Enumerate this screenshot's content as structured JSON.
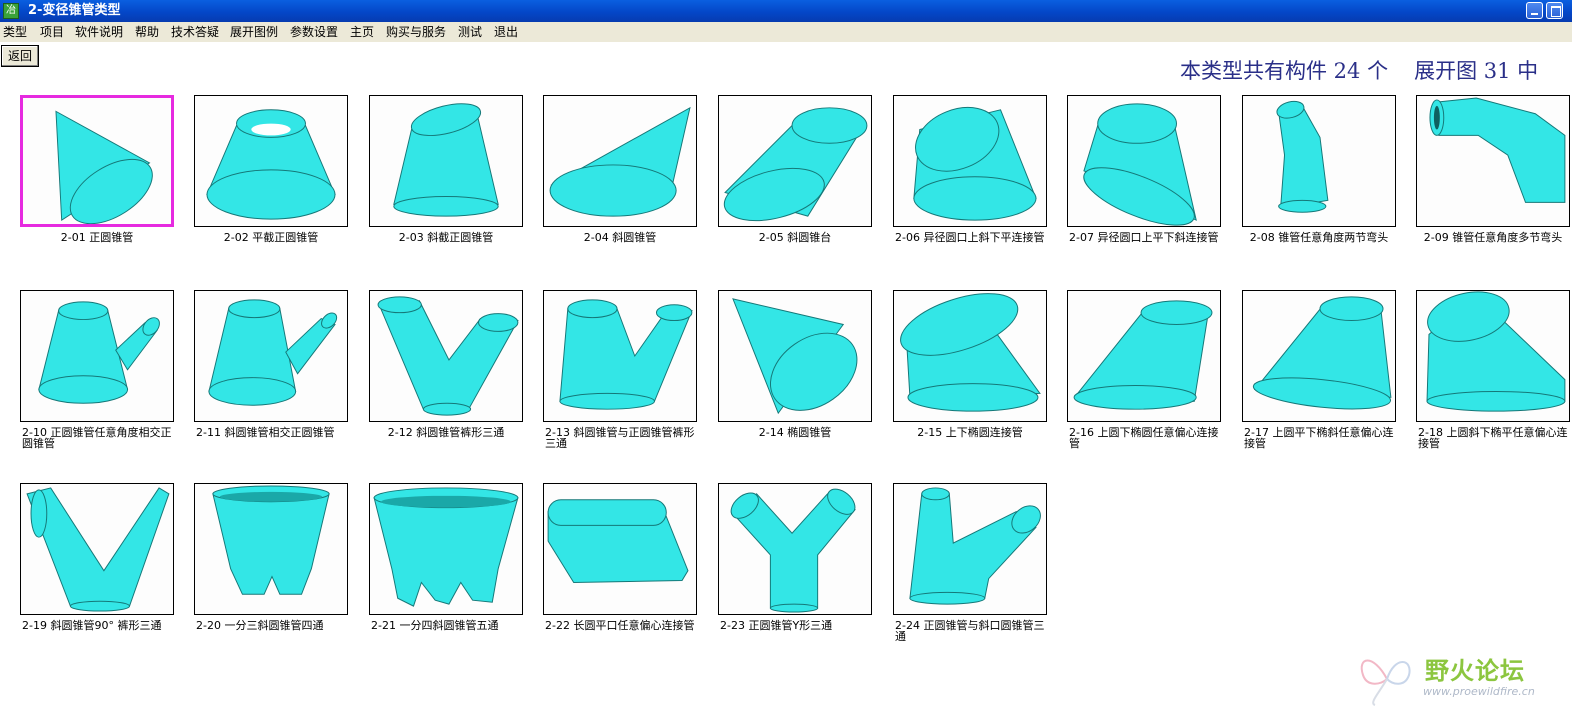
{
  "window": {
    "title": "2-变径锥管类型",
    "icon_glyph": "冶",
    "accent": "#0a5fe0"
  },
  "menu": [
    "类型",
    "项目",
    "软件说明",
    "帮助",
    "技术答疑",
    "展开图例",
    "参数设置",
    "主页",
    "购买与服务",
    "测试",
    "退出"
  ],
  "back_label": "返回",
  "summary": {
    "components_text": "本类型共有构件 24 个",
    "unfold_text": "展开图 31 中"
  },
  "colors": {
    "pipe_fill": "#33e6e6",
    "pipe_stroke": "#157878",
    "selected_border": "#e62ae0"
  },
  "items": [
    {
      "caption": "2-01 正圆锥管",
      "icon": "right-cone",
      "selected": true
    },
    {
      "caption": "2-02 平截正圆锥管",
      "icon": "frustum"
    },
    {
      "caption": "2-03 斜截正圆锥管",
      "icon": "oblique-cut-cone"
    },
    {
      "caption": "2-04 斜圆锥管",
      "icon": "oblique-cone"
    },
    {
      "caption": "2-05 斜圆锥台",
      "icon": "oblique-frustum"
    },
    {
      "caption": "2-06 异径圆口上斜下平连接管",
      "icon": "reducer-slant-top"
    },
    {
      "caption": "2-07 异径圆口上平下斜连接管",
      "icon": "reducer-slant-bottom"
    },
    {
      "caption": "2-08 锥管任意角度两节弯头",
      "icon": "two-piece-elbow"
    },
    {
      "caption": "2-09 锥管任意角度多节弯头",
      "icon": "multi-piece-elbow"
    },
    {
      "caption": "2-10 正圆锥管任意角度相交正圆锥管",
      "icon": "cone-branch"
    },
    {
      "caption": "2-11 斜圆锥管相交正圆锥管",
      "icon": "cone-branch-2"
    },
    {
      "caption": "2-12 斜圆锥管裤形三通",
      "icon": "pants-tee"
    },
    {
      "caption": "2-13 斜圆锥管与正圆锥管裤形三通",
      "icon": "pants-tee-2"
    },
    {
      "caption": "2-14 椭圆锥管",
      "icon": "elliptic-cone"
    },
    {
      "caption": "2-15 上下椭圆连接管",
      "icon": "ellipse-transition"
    },
    {
      "caption": "2-16 上圆下椭圆任意偏心连接管",
      "icon": "eccentric-transition"
    },
    {
      "caption": "2-17 上圆平下椭斜任意偏心连接管",
      "icon": "eccentric-transition-2"
    },
    {
      "caption": "2-18 上圆斜下椭平任意偏心连接管",
      "icon": "eccentric-transition-3"
    },
    {
      "caption": "2-19 斜圆锥管90° 裤形三通",
      "icon": "v-pants-tee"
    },
    {
      "caption": "2-20 一分三斜圆锥管四通",
      "icon": "four-way"
    },
    {
      "caption": "2-21 一分四斜圆锥管五通",
      "icon": "five-way"
    },
    {
      "caption": "2-22 长圆平口任意偏心连接管",
      "icon": "oblong-transition"
    },
    {
      "caption": "2-23 正圆锥管Y形三通",
      "icon": "y-tee"
    },
    {
      "caption": "2-24 正圆锥管与斜口圆锥管三通",
      "icon": "cone-tee"
    }
  ],
  "watermark": {
    "text": "野火论坛",
    "url": "www.proewildfire.cn"
  }
}
